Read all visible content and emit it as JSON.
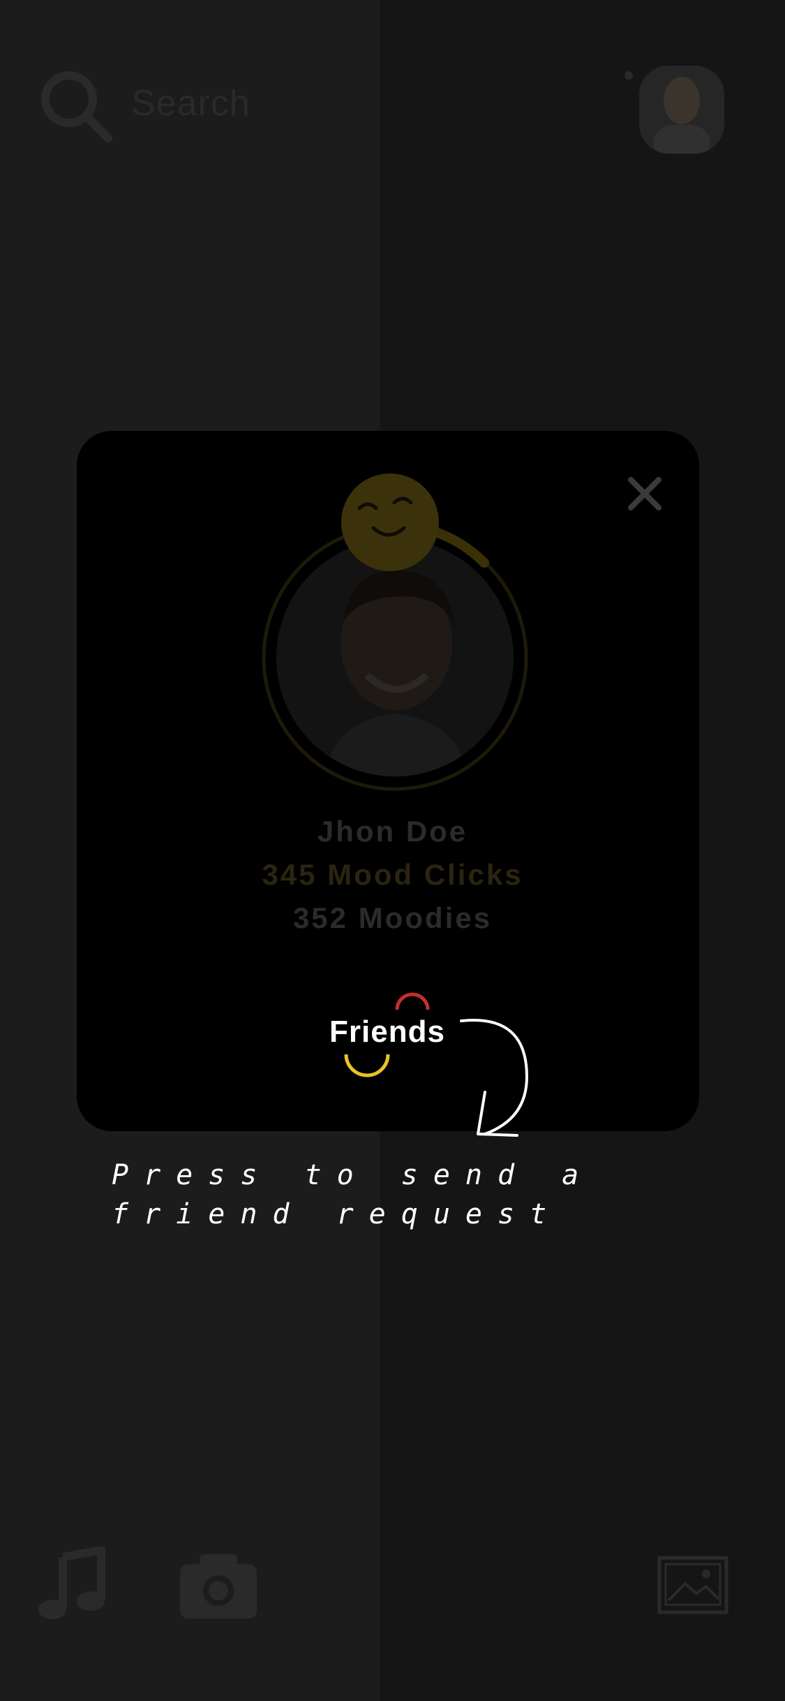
{
  "search": {
    "placeholder": "Search"
  },
  "profile": {
    "name": "Jhon Doe",
    "mood_clicks": "345 Mood Clicks",
    "moodies": "352 Moodies"
  },
  "friends_button": {
    "label": "Friends"
  },
  "hint": {
    "text": "Press to send a\nfriend request"
  },
  "colors": {
    "accent_yellow": "#e8c326",
    "accent_red": "#c22f2f",
    "modal_bg": "#000000"
  }
}
